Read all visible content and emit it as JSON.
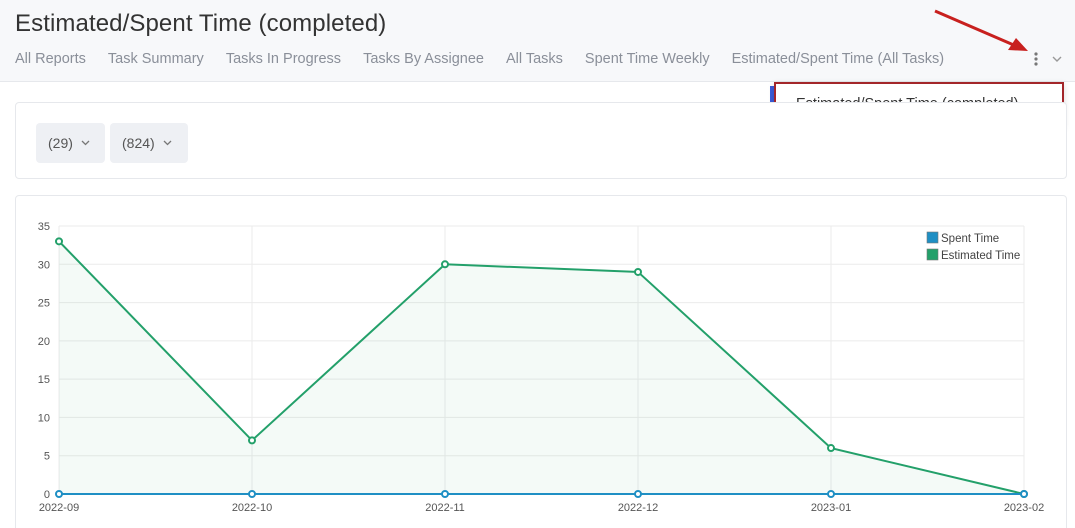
{
  "page": {
    "title": "Estimated/Spent Time (completed)"
  },
  "tabs": [
    {
      "label": "All Reports"
    },
    {
      "label": "Task Summary"
    },
    {
      "label": "Tasks In Progress"
    },
    {
      "label": "Tasks By Assignee"
    },
    {
      "label": "All Tasks"
    },
    {
      "label": "Spent Time Weekly"
    },
    {
      "label": "Estimated/Spent Time (All Tasks)"
    }
  ],
  "menu": {
    "more_icon": "more-vertical-icon",
    "chevron_icon": "chevron-down-icon"
  },
  "dropdown": {
    "item_label": "Estimated/Spent Time (completed)"
  },
  "filters": [
    {
      "label": "(29)"
    },
    {
      "label": "(824)"
    }
  ],
  "colors": {
    "spent": "#1f8fc4",
    "estimated": "#23a06a",
    "highlight_border": "#a3262a",
    "annotation_arrow": "#c8201e",
    "accent": "#3b5bd6"
  },
  "chart_data": {
    "type": "area",
    "categories": [
      "2022-09",
      "2022-10",
      "2022-11",
      "2022-12",
      "2023-01",
      "2023-02"
    ],
    "series": [
      {
        "name": "Spent Time",
        "values": [
          0,
          0,
          0,
          0,
          0,
          0
        ]
      },
      {
        "name": "Estimated Time",
        "values": [
          33,
          7,
          30,
          29,
          6,
          0
        ]
      }
    ],
    "yticks": [
      0,
      5,
      10,
      15,
      20,
      25,
      30,
      35
    ],
    "ylim": [
      0,
      35
    ],
    "grid": true,
    "legend_position": "top-right"
  }
}
